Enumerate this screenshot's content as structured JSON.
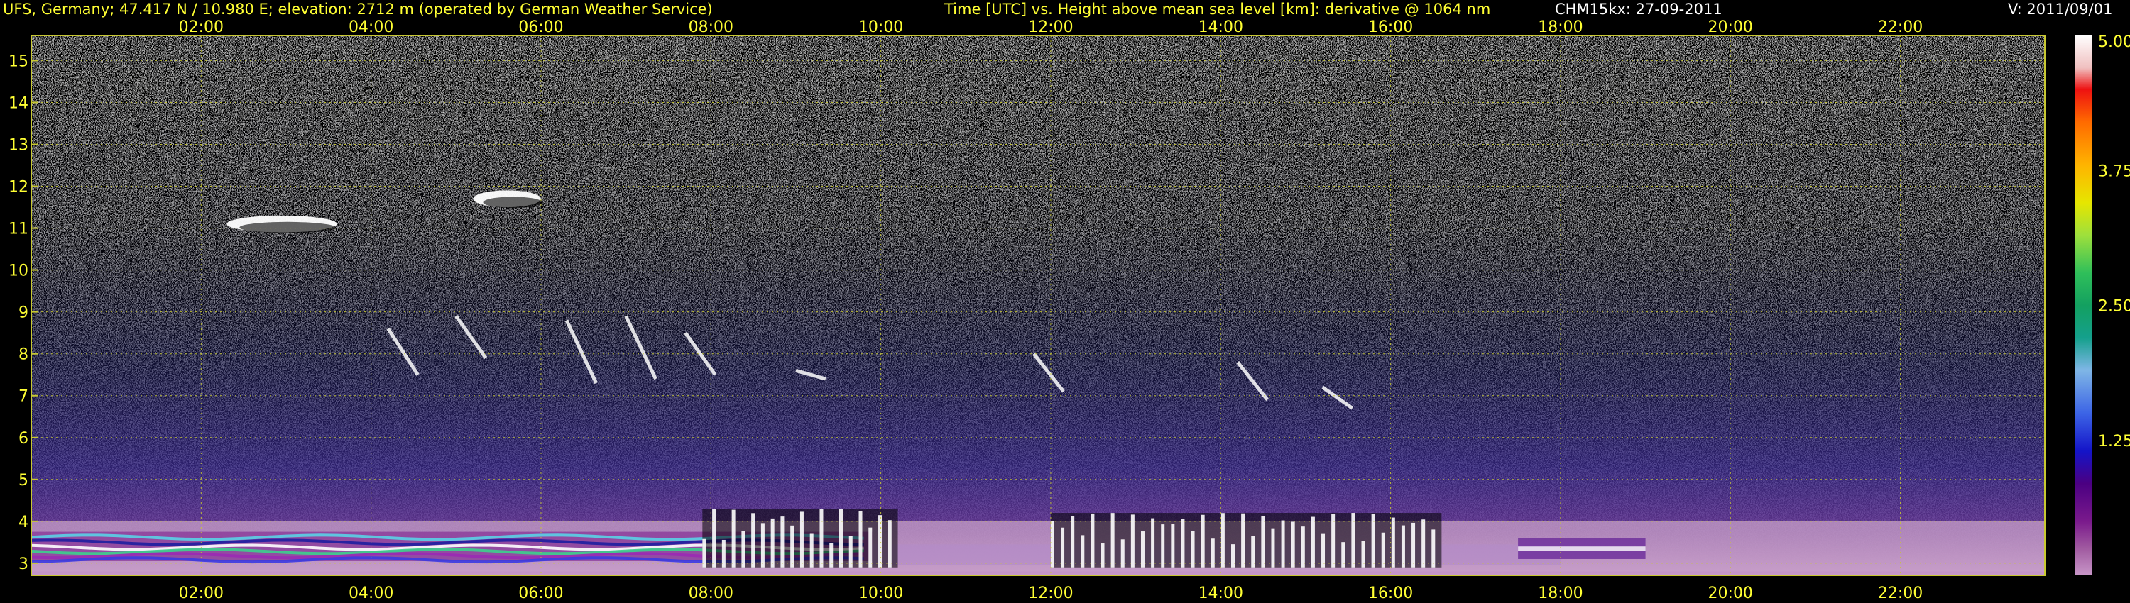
{
  "header": {
    "left": "UFS, Germany; 47.417 N / 10.980 E; elevation: 2712 m  (operated by German Weather Service)",
    "center": "Time [UTC] vs. Height above mean sea level [km]: derivative @ 1064 nm",
    "instrument": "CHM15kx: 27-09-2011",
    "version": "V: 2011/09/01"
  },
  "colors": {
    "background": "#000000",
    "grid": "#c8c832",
    "tick_text": "#ffff33",
    "header_text": "#ffff33",
    "header_text_white": "#ffffff"
  },
  "chart_data": {
    "type": "heatmap",
    "title": "Time [UTC] vs. Height above mean sea level [km]: derivative @ 1064 nm",
    "xlabel": "Time [UTC]",
    "ylabel": "Height above mean sea level [km]",
    "x_ticks": [
      "02:00",
      "04:00",
      "06:00",
      "08:00",
      "10:00",
      "12:00",
      "14:00",
      "16:00",
      "18:00",
      "20:00",
      "22:00"
    ],
    "x_tick_hours": [
      2,
      4,
      6,
      8,
      10,
      12,
      14,
      16,
      18,
      20,
      22
    ],
    "xlim": [
      0,
      23.7
    ],
    "y_ticks": [
      3,
      4,
      5,
      6,
      7,
      8,
      9,
      10,
      11,
      12,
      13,
      14,
      15
    ],
    "ylim": [
      2.71,
      15.6
    ],
    "grid": true,
    "colorbar": {
      "ticks": [
        "5.00",
        "3.75",
        "2.50",
        "1.25"
      ],
      "tick_values": [
        5.0,
        3.75,
        2.5,
        1.25
      ],
      "range": [
        0,
        5.0
      ],
      "colors": [
        "#ffffff",
        "#ee1111",
        "#ff6a00",
        "#ffb400",
        "#e6e600",
        "#9ee03c",
        "#2fbf5a",
        "#13a060",
        "#14a08c",
        "#7fb6e6",
        "#3c64e6",
        "#1414c8",
        "#4b0082",
        "#7a1a8c",
        "#a05aa0",
        "#c896c8"
      ]
    },
    "features": [
      {
        "name": "boundary layer",
        "from_hour": 0,
        "to_hour": 23.7,
        "height_km": [
          2.8,
          4.0
        ]
      },
      {
        "name": "cirrus",
        "from_hour": 2.3,
        "to_hour": 3.6,
        "height_km": [
          10.9,
          11.3
        ]
      },
      {
        "name": "cirrus",
        "from_hour": 5.2,
        "to_hour": 6.0,
        "height_km": [
          11.5,
          11.9
        ]
      },
      {
        "name": "clouds",
        "from_hour": 7.9,
        "to_hour": 10.2,
        "height_km": [
          2.9,
          4.3
        ]
      },
      {
        "name": "clouds",
        "from_hour": 12.0,
        "to_hour": 16.6,
        "height_km": [
          2.9,
          4.2
        ]
      },
      {
        "name": "aerosol layer",
        "from_hour": 17.5,
        "to_hour": 19.0,
        "height_km": [
          3.1,
          3.6
        ]
      }
    ]
  }
}
